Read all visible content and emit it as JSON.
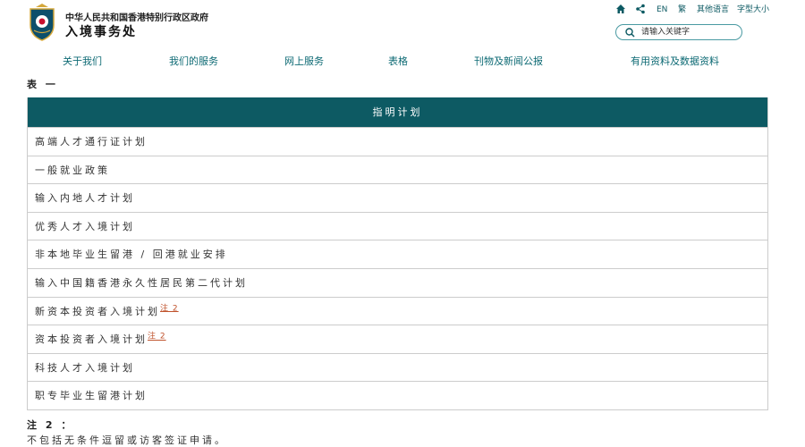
{
  "header": {
    "government_name": "中华人民共和国香港特别行政区政府",
    "department_name": "入境事务处",
    "logo_icon": "hkid-emblem-icon",
    "utility": {
      "home_icon": "home-icon",
      "share_icon": "share-icon",
      "english": "EN",
      "traditional": "繁",
      "other_languages": "其他语言",
      "font_size": "字型大小"
    },
    "search": {
      "placeholder": "请输入关键字",
      "value": "",
      "icon": "search-icon"
    },
    "nav": [
      {
        "label": "关于我们"
      },
      {
        "label": "我们的服务"
      },
      {
        "label": "网上服务"
      },
      {
        "label": "表格"
      },
      {
        "label": "刊物及新闻公报"
      },
      {
        "label": "有用资料及数据资料"
      }
    ],
    "accent_color": "#0d5a63"
  },
  "main": {
    "table_caption": "表 一",
    "table": {
      "header": "指明计划",
      "rows": [
        {
          "label": "高端人才通行证计划",
          "note": ""
        },
        {
          "label": "一般就业政策",
          "note": ""
        },
        {
          "label": "输入内地人才计划",
          "note": ""
        },
        {
          "label": "优秀人才入境计划",
          "note": ""
        },
        {
          "label": "非本地毕业生留港 / 回港就业安排",
          "note": ""
        },
        {
          "label": "输入中国籍香港永久性居民第二代计划",
          "note": ""
        },
        {
          "label": "新资本投资者入境计划",
          "note": "注 2"
        },
        {
          "label": "资本投资者入境计划",
          "note": "注 2"
        },
        {
          "label": "科技人才入境计划",
          "note": ""
        },
        {
          "label": "职专毕业生留港计划",
          "note": ""
        }
      ]
    },
    "note": {
      "title": "注 2 ：",
      "text": "不包括无条件逗留或访客签证申请。"
    },
    "link_color": "#c0532d"
  }
}
